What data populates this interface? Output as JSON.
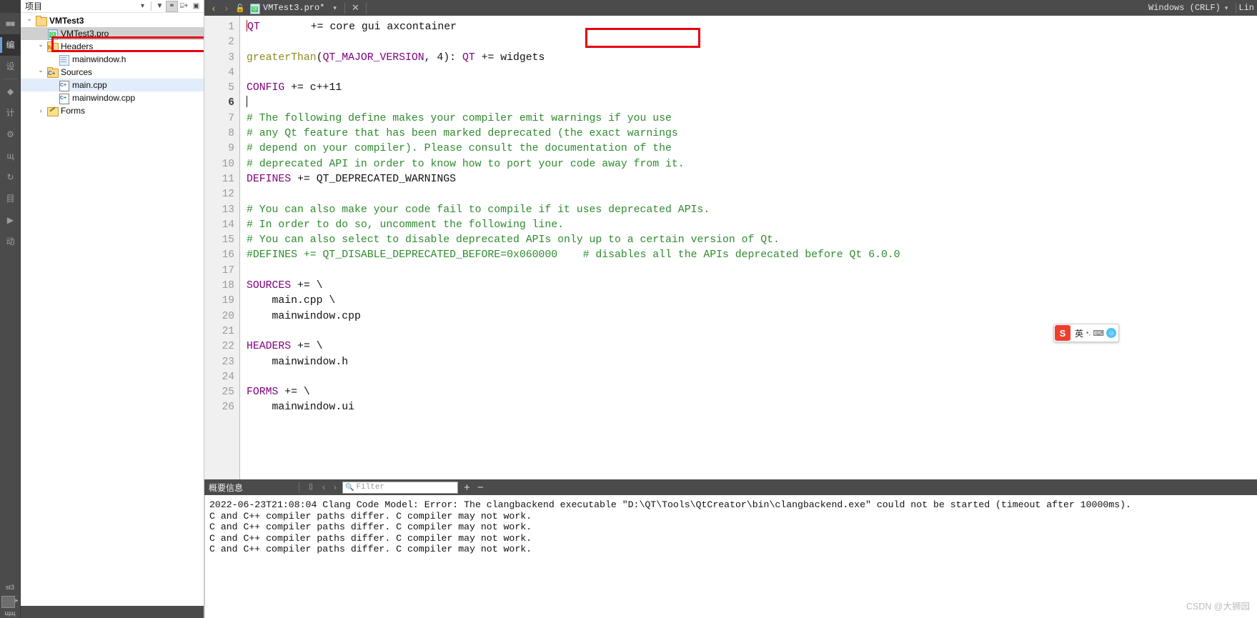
{
  "mode_bar": {
    "items": [
      {
        "name": "welcome",
        "glyph": "■■"
      },
      {
        "name": "edit",
        "glyph": "编",
        "active": true
      },
      {
        "name": "design",
        "glyph": "设"
      },
      {
        "name": "debug",
        "glyph": "◆"
      },
      {
        "name": "projects",
        "glyph": "计"
      },
      {
        "name": "help",
        "glyph": "⚙"
      },
      {
        "name": "analyze",
        "glyph": "щ"
      },
      {
        "name": "tests",
        "glyph": "↻"
      },
      {
        "name": "project-label",
        "glyph": "目"
      },
      {
        "name": "run",
        "glyph": "▶"
      },
      {
        "name": "build",
        "glyph": "动"
      }
    ],
    "kit_label": "st3",
    "run_label": "щщ"
  },
  "sidebar": {
    "title": "项目",
    "header_buttons": [
      {
        "name": "filter-dropdown",
        "glyph": "▾"
      },
      {
        "name": "filter-funnel",
        "glyph": "▼"
      },
      {
        "name": "link-with-editor",
        "glyph": "⚭"
      },
      {
        "name": "split-add",
        "glyph": "⌸+"
      },
      {
        "name": "close-split",
        "glyph": "▣"
      }
    ],
    "tree": [
      {
        "label": "VMTest3",
        "icon": "folder",
        "indent": 0,
        "twisty": "open",
        "state": "none",
        "badge": ""
      },
      {
        "label": "VMTest3.pro",
        "icon": "profile",
        "indent": 1,
        "twisty": "none",
        "state": "sel-grey",
        "badge": ""
      },
      {
        "label": "Headers",
        "icon": "folder",
        "indent": 1,
        "twisty": "open",
        "state": "none",
        "badge": "h"
      },
      {
        "label": "mainwindow.h",
        "icon": "hfile",
        "indent": 2,
        "twisty": "none",
        "state": "none",
        "badge": ""
      },
      {
        "label": "Sources",
        "icon": "folder",
        "indent": 1,
        "twisty": "open",
        "state": "none",
        "badge": "C+"
      },
      {
        "label": "main.cpp",
        "icon": "cpp",
        "indent": 2,
        "twisty": "none",
        "state": "sel-blue",
        "badge": ""
      },
      {
        "label": "mainwindow.cpp",
        "icon": "cpp",
        "indent": 2,
        "twisty": "none",
        "state": "none",
        "badge": ""
      },
      {
        "label": "Forms",
        "icon": "forms",
        "indent": 1,
        "twisty": "closed",
        "state": "none",
        "badge": ""
      }
    ]
  },
  "editor_toolbar": {
    "back_glyph": "‹",
    "forward_glyph": "›",
    "lock_glyph": "🔓",
    "filename": "VMTest3.pro*",
    "dropdown_glyph": "▾",
    "close_glyph": "✕",
    "eol": "Windows (CRLF)",
    "eol_caret": "▾",
    "encoding": "Lin"
  },
  "editor": {
    "current_line": 6,
    "lines": [
      {
        "n": 1,
        "tokens": [
          {
            "t": "QT",
            "c": "tk-var"
          },
          {
            "t": "        += core gui ",
            "c": "tk-plain"
          },
          {
            "t": "axcontainer",
            "c": "tk-plain"
          }
        ]
      },
      {
        "n": 2,
        "tokens": []
      },
      {
        "n": 3,
        "tokens": [
          {
            "t": "greaterThan",
            "c": "tk-fn"
          },
          {
            "t": "(",
            "c": "tk-paren"
          },
          {
            "t": "QT_MAJOR_VERSION",
            "c": "tk-var"
          },
          {
            "t": ", 4): ",
            "c": "tk-plain"
          },
          {
            "t": "QT",
            "c": "tk-var"
          },
          {
            "t": " += widgets",
            "c": "tk-plain"
          }
        ]
      },
      {
        "n": 4,
        "tokens": []
      },
      {
        "n": 5,
        "tokens": [
          {
            "t": "CONFIG",
            "c": "tk-var"
          },
          {
            "t": " += c++11",
            "c": "tk-plain"
          }
        ]
      },
      {
        "n": 6,
        "tokens": []
      },
      {
        "n": 7,
        "tokens": [
          {
            "t": "# The following define makes your compiler emit warnings if you use",
            "c": "tk-cmt"
          }
        ]
      },
      {
        "n": 8,
        "tokens": [
          {
            "t": "# any Qt feature that has been marked deprecated (the exact warnings",
            "c": "tk-cmt"
          }
        ]
      },
      {
        "n": 9,
        "tokens": [
          {
            "t": "# depend on your compiler). Please consult the documentation of the",
            "c": "tk-cmt"
          }
        ]
      },
      {
        "n": 10,
        "tokens": [
          {
            "t": "# deprecated API in order to know how to port your code away from it.",
            "c": "tk-cmt"
          }
        ]
      },
      {
        "n": 11,
        "tokens": [
          {
            "t": "DEFINES",
            "c": "tk-var"
          },
          {
            "t": " += QT_DEPRECATED_WARNINGS",
            "c": "tk-plain"
          }
        ]
      },
      {
        "n": 12,
        "tokens": []
      },
      {
        "n": 13,
        "tokens": [
          {
            "t": "# You can also make your code fail to compile if it uses deprecated APIs.",
            "c": "tk-cmt"
          }
        ]
      },
      {
        "n": 14,
        "tokens": [
          {
            "t": "# In order to do so, uncomment the following line.",
            "c": "tk-cmt"
          }
        ]
      },
      {
        "n": 15,
        "tokens": [
          {
            "t": "# You can also select to disable deprecated APIs only up to a certain version of Qt.",
            "c": "tk-cmt"
          }
        ]
      },
      {
        "n": 16,
        "tokens": [
          {
            "t": "#DEFINES += QT_DISABLE_DEPRECATED_BEFORE=0x060000    # disables all the APIs deprecated before Qt 6.0.0",
            "c": "tk-cmt"
          }
        ]
      },
      {
        "n": 17,
        "tokens": []
      },
      {
        "n": 18,
        "tokens": [
          {
            "t": "SOURCES",
            "c": "tk-var"
          },
          {
            "t": " += \\",
            "c": "tk-plain"
          }
        ]
      },
      {
        "n": 19,
        "tokens": [
          {
            "t": "    main.cpp \\",
            "c": "tk-plain"
          }
        ]
      },
      {
        "n": 20,
        "tokens": [
          {
            "t": "    mainwindow.cpp",
            "c": "tk-plain"
          }
        ]
      },
      {
        "n": 21,
        "tokens": []
      },
      {
        "n": 22,
        "tokens": [
          {
            "t": "HEADERS",
            "c": "tk-var"
          },
          {
            "t": " += \\",
            "c": "tk-plain"
          }
        ]
      },
      {
        "n": 23,
        "tokens": [
          {
            "t": "    mainwindow.h",
            "c": "tk-plain"
          }
        ]
      },
      {
        "n": 24,
        "tokens": []
      },
      {
        "n": 25,
        "tokens": [
          {
            "t": "FORMS",
            "c": "tk-var"
          },
          {
            "t": " += \\",
            "c": "tk-plain"
          }
        ]
      },
      {
        "n": 26,
        "tokens": [
          {
            "t": "    mainwindow.ui",
            "c": "tk-plain"
          }
        ]
      }
    ],
    "highlight_token": "axcontainer"
  },
  "output_pane": {
    "title": "概要信息",
    "clear_glyph": "⌷",
    "prev_glyph": "‹",
    "next_glyph": "›",
    "filter_placeholder": "Filter",
    "filter_value": "",
    "zoom_in": "+",
    "zoom_out": "−",
    "lines": [
      "2022-06-23T21:08:04 Clang Code Model: Error: The clangbackend executable \"D:\\QT\\Tools\\QtCreator\\bin\\clangbackend.exe\" could not be started (timeout after 10000ms).",
      "C and C++ compiler paths differ. C compiler may not work.",
      "C and C++ compiler paths differ. C compiler may not work.",
      "C and C++ compiler paths differ. C compiler may not work.",
      "C and C++ compiler paths differ. C compiler may not work."
    ]
  },
  "ime_widget": {
    "logo": "S",
    "mode_label": "英",
    "dots": "•,",
    "keyboard": "⌨",
    "smiley": "☺"
  },
  "watermark": {
    "text": "CSDN @大狮园"
  },
  "colors": {
    "accent_red": "#e60012",
    "comment_green": "#2e8b2e",
    "variable_purple": "#800080",
    "function_olive": "#8a8a20",
    "chrome_dark": "#4b4b4b",
    "selection_blue": "#e2edfb"
  }
}
